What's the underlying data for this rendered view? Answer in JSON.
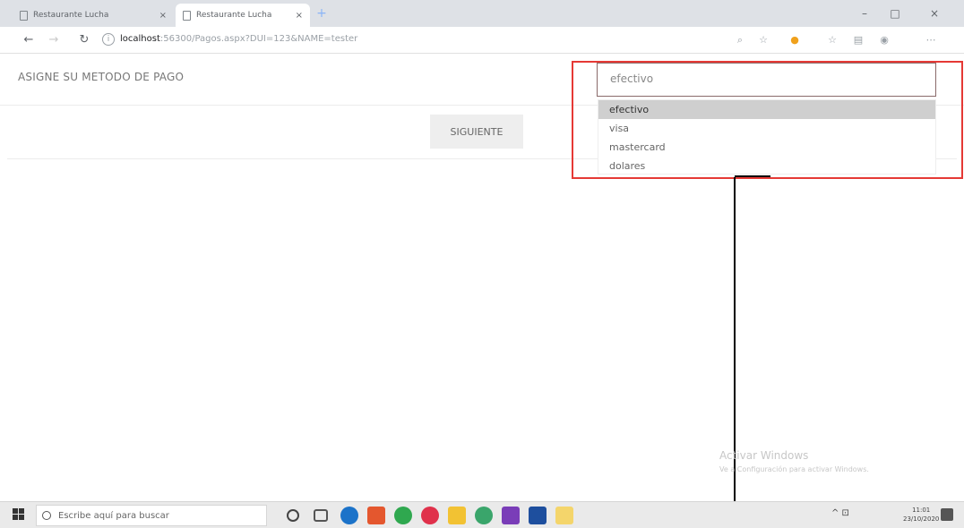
{
  "browser": {
    "tabs": [
      {
        "title": "Restaurante Lucha"
      },
      {
        "title": "Restaurante Lucha"
      }
    ],
    "new_tab_glyph": "+",
    "window_controls": [
      "–",
      "□",
      "×"
    ],
    "url_host": "localhost",
    "url_path": ":56300/Pagos.aspx?DUI=123&NAME=tester",
    "nav": {
      "back": "←",
      "forward": "→",
      "reload": "↻",
      "info": "i"
    },
    "toolbar_icons": [
      "search-icon",
      "star-icon",
      "extension-icon",
      "favorites-icon",
      "collections-icon",
      "profile-icon",
      "more-icon"
    ],
    "toolbar_glyphs": [
      "⌕",
      "☆",
      "●",
      "☆",
      "▤",
      "◉",
      "⋯"
    ]
  },
  "page": {
    "pay_label": "ASIGNE SU METODO DE PAGO",
    "select_value": "efectivo",
    "next_button": "SIGUIENTE",
    "options": [
      "efectivo",
      "visa",
      "mastercard",
      "dolares"
    ],
    "selected_option_index": 0
  },
  "watermark": {
    "title": "Activar Windows",
    "subtitle": "Ve a Configuración para activar Windows."
  },
  "taskbar": {
    "search_placeholder": "Escribe aquí para buscar",
    "clock_time": "11:01",
    "clock_date": "23/10/2020",
    "tray_glyphs": "^ ⊡"
  },
  "colors": {
    "highlight_box": "#e53935",
    "selected_option_bg": "#cfcfcf",
    "select_border": "#8a6a6a"
  }
}
